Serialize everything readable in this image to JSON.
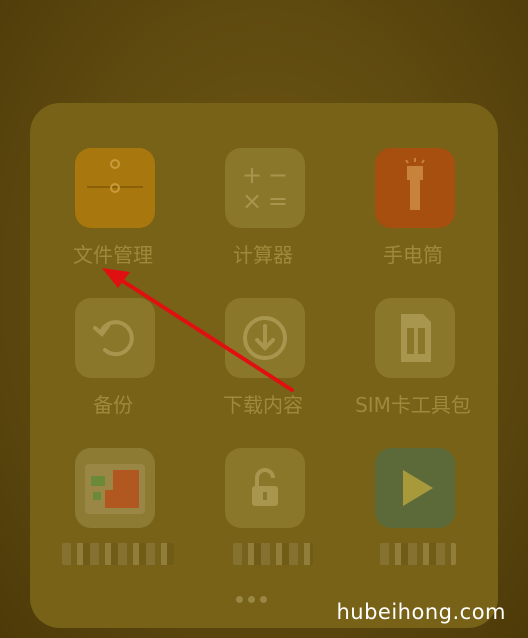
{
  "folder": {
    "apps": [
      {
        "label": "文件管理",
        "icon": "folder-file-manager-icon"
      },
      {
        "label": "计算器",
        "icon": "calculator-icon"
      },
      {
        "label": "手电筒",
        "icon": "flashlight-icon"
      },
      {
        "label": "备份",
        "icon": "backup-icon"
      },
      {
        "label": "下载内容",
        "icon": "download-icon"
      },
      {
        "label": "SIM卡工具包",
        "icon": "sim-card-icon"
      },
      {
        "label": "",
        "icon": "sim-app-icon"
      },
      {
        "label": "",
        "icon": "lock-icon"
      },
      {
        "label": "",
        "icon": "play-icon"
      }
    ],
    "calculator_glyphs": [
      "+",
      "−",
      "×",
      "="
    ]
  },
  "watermark": "hubeihong.com",
  "colors": {
    "annotation_arrow": "#e01010",
    "file_manager_tile": "#a8770e",
    "flashlight_tile": "#a64f0e",
    "play_tile": "#5c6a3a"
  }
}
